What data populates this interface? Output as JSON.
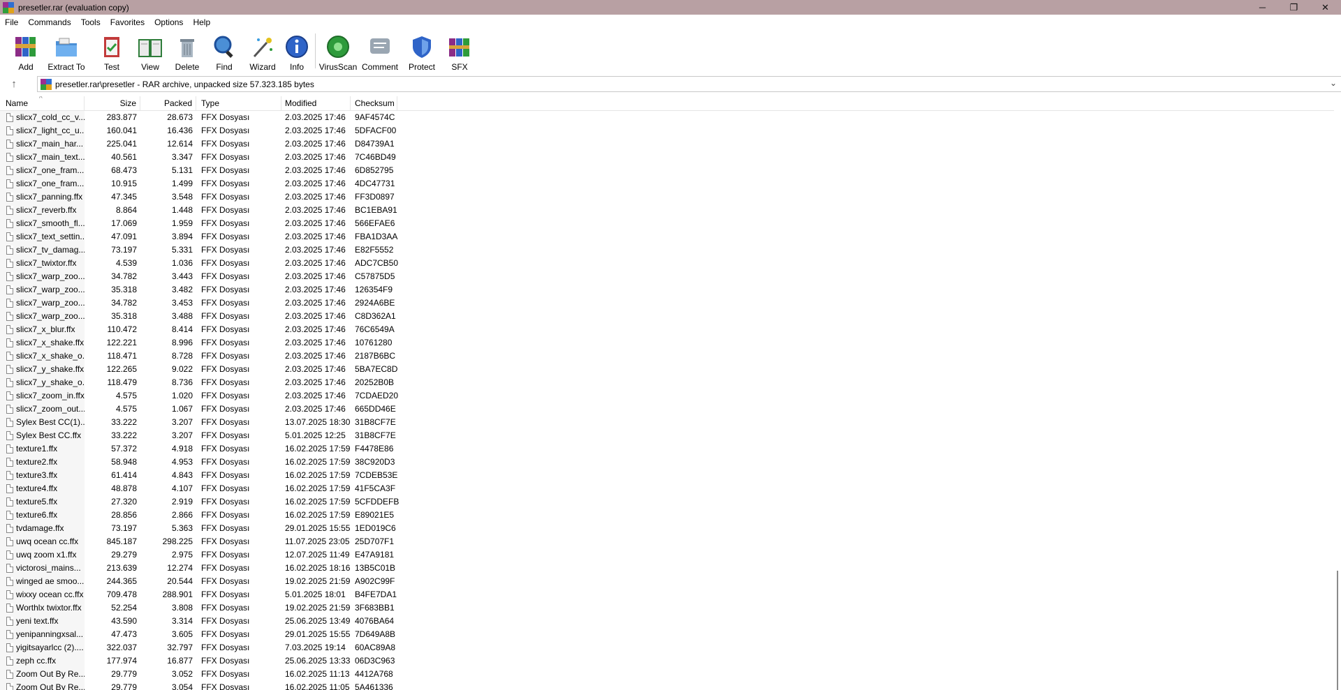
{
  "window": {
    "title": "presetler.rar (evaluation copy)",
    "controls": {
      "minimize": "─",
      "maximize": "❐",
      "close": "✕"
    }
  },
  "menu": [
    "File",
    "Commands",
    "Tools",
    "Favorites",
    "Options",
    "Help"
  ],
  "toolbar": [
    {
      "label": "Add",
      "icon": "books-stack-icon"
    },
    {
      "label": "Extract To",
      "icon": "folder-extract-icon"
    },
    {
      "label": "Test",
      "icon": "clipboard-test-icon"
    },
    {
      "label": "View",
      "icon": "open-book-icon"
    },
    {
      "label": "Delete",
      "icon": "trash-can-icon"
    },
    {
      "label": "Find",
      "icon": "magnifier-icon"
    },
    {
      "label": "Wizard",
      "icon": "magic-wand-icon"
    },
    {
      "label": "Info",
      "icon": "info-circle-icon"
    },
    {
      "label": "VirusScan",
      "icon": "virus-scan-icon"
    },
    {
      "label": "Comment",
      "icon": "comment-icon"
    },
    {
      "label": "Protect",
      "icon": "shield-icon"
    },
    {
      "label": "SFX",
      "icon": "sfx-archive-icon"
    }
  ],
  "address": {
    "path": "presetler.rar\\presetler - RAR archive, unpacked size 57.323.185 bytes"
  },
  "columns": {
    "name": "Name",
    "size": "Size",
    "packed": "Packed",
    "type": "Type",
    "modified": "Modified",
    "checksum": "Checksum"
  },
  "files": [
    [
      "slicx7_cold_cc_v...",
      "283.877",
      "28.673",
      "FFX Dosyası",
      "2.03.2025 17:46",
      "9AF4574C"
    ],
    [
      "slicx7_light_cc_u...",
      "160.041",
      "16.436",
      "FFX Dosyası",
      "2.03.2025 17:46",
      "5DFACF00"
    ],
    [
      "slicx7_main_har...",
      "225.041",
      "12.614",
      "FFX Dosyası",
      "2.03.2025 17:46",
      "D84739A1"
    ],
    [
      "slicx7_main_text...",
      "40.561",
      "3.347",
      "FFX Dosyası",
      "2.03.2025 17:46",
      "7C46BD49"
    ],
    [
      "slicx7_one_fram...",
      "68.473",
      "5.131",
      "FFX Dosyası",
      "2.03.2025 17:46",
      "6D852795"
    ],
    [
      "slicx7_one_fram...",
      "10.915",
      "1.499",
      "FFX Dosyası",
      "2.03.2025 17:46",
      "4DC47731"
    ],
    [
      "slicx7_panning.ffx",
      "47.345",
      "3.548",
      "FFX Dosyası",
      "2.03.2025 17:46",
      "FF3D0897"
    ],
    [
      "slicx7_reverb.ffx",
      "8.864",
      "1.448",
      "FFX Dosyası",
      "2.03.2025 17:46",
      "BC1EBA91"
    ],
    [
      "slicx7_smooth_fl...",
      "17.069",
      "1.959",
      "FFX Dosyası",
      "2.03.2025 17:46",
      "566EFAE6"
    ],
    [
      "slicx7_text_settin...",
      "47.091",
      "3.894",
      "FFX Dosyası",
      "2.03.2025 17:46",
      "FBA1D3AA"
    ],
    [
      "slicx7_tv_damag...",
      "73.197",
      "5.331",
      "FFX Dosyası",
      "2.03.2025 17:46",
      "E82F5552"
    ],
    [
      "slicx7_twixtor.ffx",
      "4.539",
      "1.036",
      "FFX Dosyası",
      "2.03.2025 17:46",
      "ADC7CB50"
    ],
    [
      "slicx7_warp_zoo...",
      "34.782",
      "3.443",
      "FFX Dosyası",
      "2.03.2025 17:46",
      "C57875D5"
    ],
    [
      "slicx7_warp_zoo...",
      "35.318",
      "3.482",
      "FFX Dosyası",
      "2.03.2025 17:46",
      "126354F9"
    ],
    [
      "slicx7_warp_zoo...",
      "34.782",
      "3.453",
      "FFX Dosyası",
      "2.03.2025 17:46",
      "2924A6BE"
    ],
    [
      "slicx7_warp_zoo...",
      "35.318",
      "3.488",
      "FFX Dosyası",
      "2.03.2025 17:46",
      "C8D362A1"
    ],
    [
      "slicx7_x_blur.ffx",
      "110.472",
      "8.414",
      "FFX Dosyası",
      "2.03.2025 17:46",
      "76C6549A"
    ],
    [
      "slicx7_x_shake.ffx",
      "122.221",
      "8.996",
      "FFX Dosyası",
      "2.03.2025 17:46",
      "10761280"
    ],
    [
      "slicx7_x_shake_o...",
      "118.471",
      "8.728",
      "FFX Dosyası",
      "2.03.2025 17:46",
      "2187B6BC"
    ],
    [
      "slicx7_y_shake.ffx",
      "122.265",
      "9.022",
      "FFX Dosyası",
      "2.03.2025 17:46",
      "5BA7EC8D"
    ],
    [
      "slicx7_y_shake_o...",
      "118.479",
      "8.736",
      "FFX Dosyası",
      "2.03.2025 17:46",
      "20252B0B"
    ],
    [
      "slicx7_zoom_in.ffx",
      "4.575",
      "1.020",
      "FFX Dosyası",
      "2.03.2025 17:46",
      "7CDAED20"
    ],
    [
      "slicx7_zoom_out...",
      "4.575",
      "1.067",
      "FFX Dosyası",
      "2.03.2025 17:46",
      "665DD46E"
    ],
    [
      "Sylex Best CC(1)....",
      "33.222",
      "3.207",
      "FFX Dosyası",
      "13.07.2025 18:30",
      "31B8CF7E"
    ],
    [
      "Sylex Best CC.ffx",
      "33.222",
      "3.207",
      "FFX Dosyası",
      "5.01.2025 12:25",
      "31B8CF7E"
    ],
    [
      "texture1.ffx",
      "57.372",
      "4.918",
      "FFX Dosyası",
      "16.02.2025 17:59",
      "F4478E86"
    ],
    [
      "texture2.ffx",
      "58.948",
      "4.953",
      "FFX Dosyası",
      "16.02.2025 17:59",
      "38C920D3"
    ],
    [
      "texture3.ffx",
      "61.414",
      "4.843",
      "FFX Dosyası",
      "16.02.2025 17:59",
      "7CDEB53E"
    ],
    [
      "texture4.ffx",
      "48.878",
      "4.107",
      "FFX Dosyası",
      "16.02.2025 17:59",
      "41F5CA3F"
    ],
    [
      "texture5.ffx",
      "27.320",
      "2.919",
      "FFX Dosyası",
      "16.02.2025 17:59",
      "5CFDDEFB"
    ],
    [
      "texture6.ffx",
      "28.856",
      "2.866",
      "FFX Dosyası",
      "16.02.2025 17:59",
      "E89021E5"
    ],
    [
      "tvdamage.ffx",
      "73.197",
      "5.363",
      "FFX Dosyası",
      "29.01.2025 15:55",
      "1ED019C6"
    ],
    [
      "uwq ocean cc.ffx",
      "845.187",
      "298.225",
      "FFX Dosyası",
      "11.07.2025 23:05",
      "25D707F1"
    ],
    [
      "uwq zoom x1.ffx",
      "29.279",
      "2.975",
      "FFX Dosyası",
      "12.07.2025 11:49",
      "E47A9181"
    ],
    [
      "victorosi_mains...",
      "213.639",
      "12.274",
      "FFX Dosyası",
      "16.02.2025 18:16",
      "13B5C01B"
    ],
    [
      "winged ae smoo...",
      "244.365",
      "20.544",
      "FFX Dosyası",
      "19.02.2025 21:59",
      "A902C99F"
    ],
    [
      "wixxy ocean cc.ffx",
      "709.478",
      "288.901",
      "FFX Dosyası",
      "5.01.2025 18:01",
      "B4FE7DA1"
    ],
    [
      "Worthlx twixtor.ffx",
      "52.254",
      "3.808",
      "FFX Dosyası",
      "19.02.2025 21:59",
      "3F683BB1"
    ],
    [
      "yeni text.ffx",
      "43.590",
      "3.314",
      "FFX Dosyası",
      "25.06.2025 13:49",
      "4076BA64"
    ],
    [
      "yenipanningxsal...",
      "47.473",
      "3.605",
      "FFX Dosyası",
      "29.01.2025 15:55",
      "7D649A8B"
    ],
    [
      "yigitsayarlcc (2)....",
      "322.037",
      "32.797",
      "FFX Dosyası",
      "7.03.2025 19:14",
      "60AC89A8"
    ],
    [
      "zeph cc.ffx",
      "177.974",
      "16.877",
      "FFX Dosyası",
      "25.06.2025 13:33",
      "06D3C963"
    ],
    [
      "Zoom Out By Re...",
      "29.779",
      "3.052",
      "FFX Dosyası",
      "16.02.2025 11:13",
      "4412A768"
    ],
    [
      "Zoom Out By Re...",
      "29.779",
      "3.054",
      "FFX Dosyası",
      "16.02.2025 11:05",
      "5A461336"
    ]
  ]
}
